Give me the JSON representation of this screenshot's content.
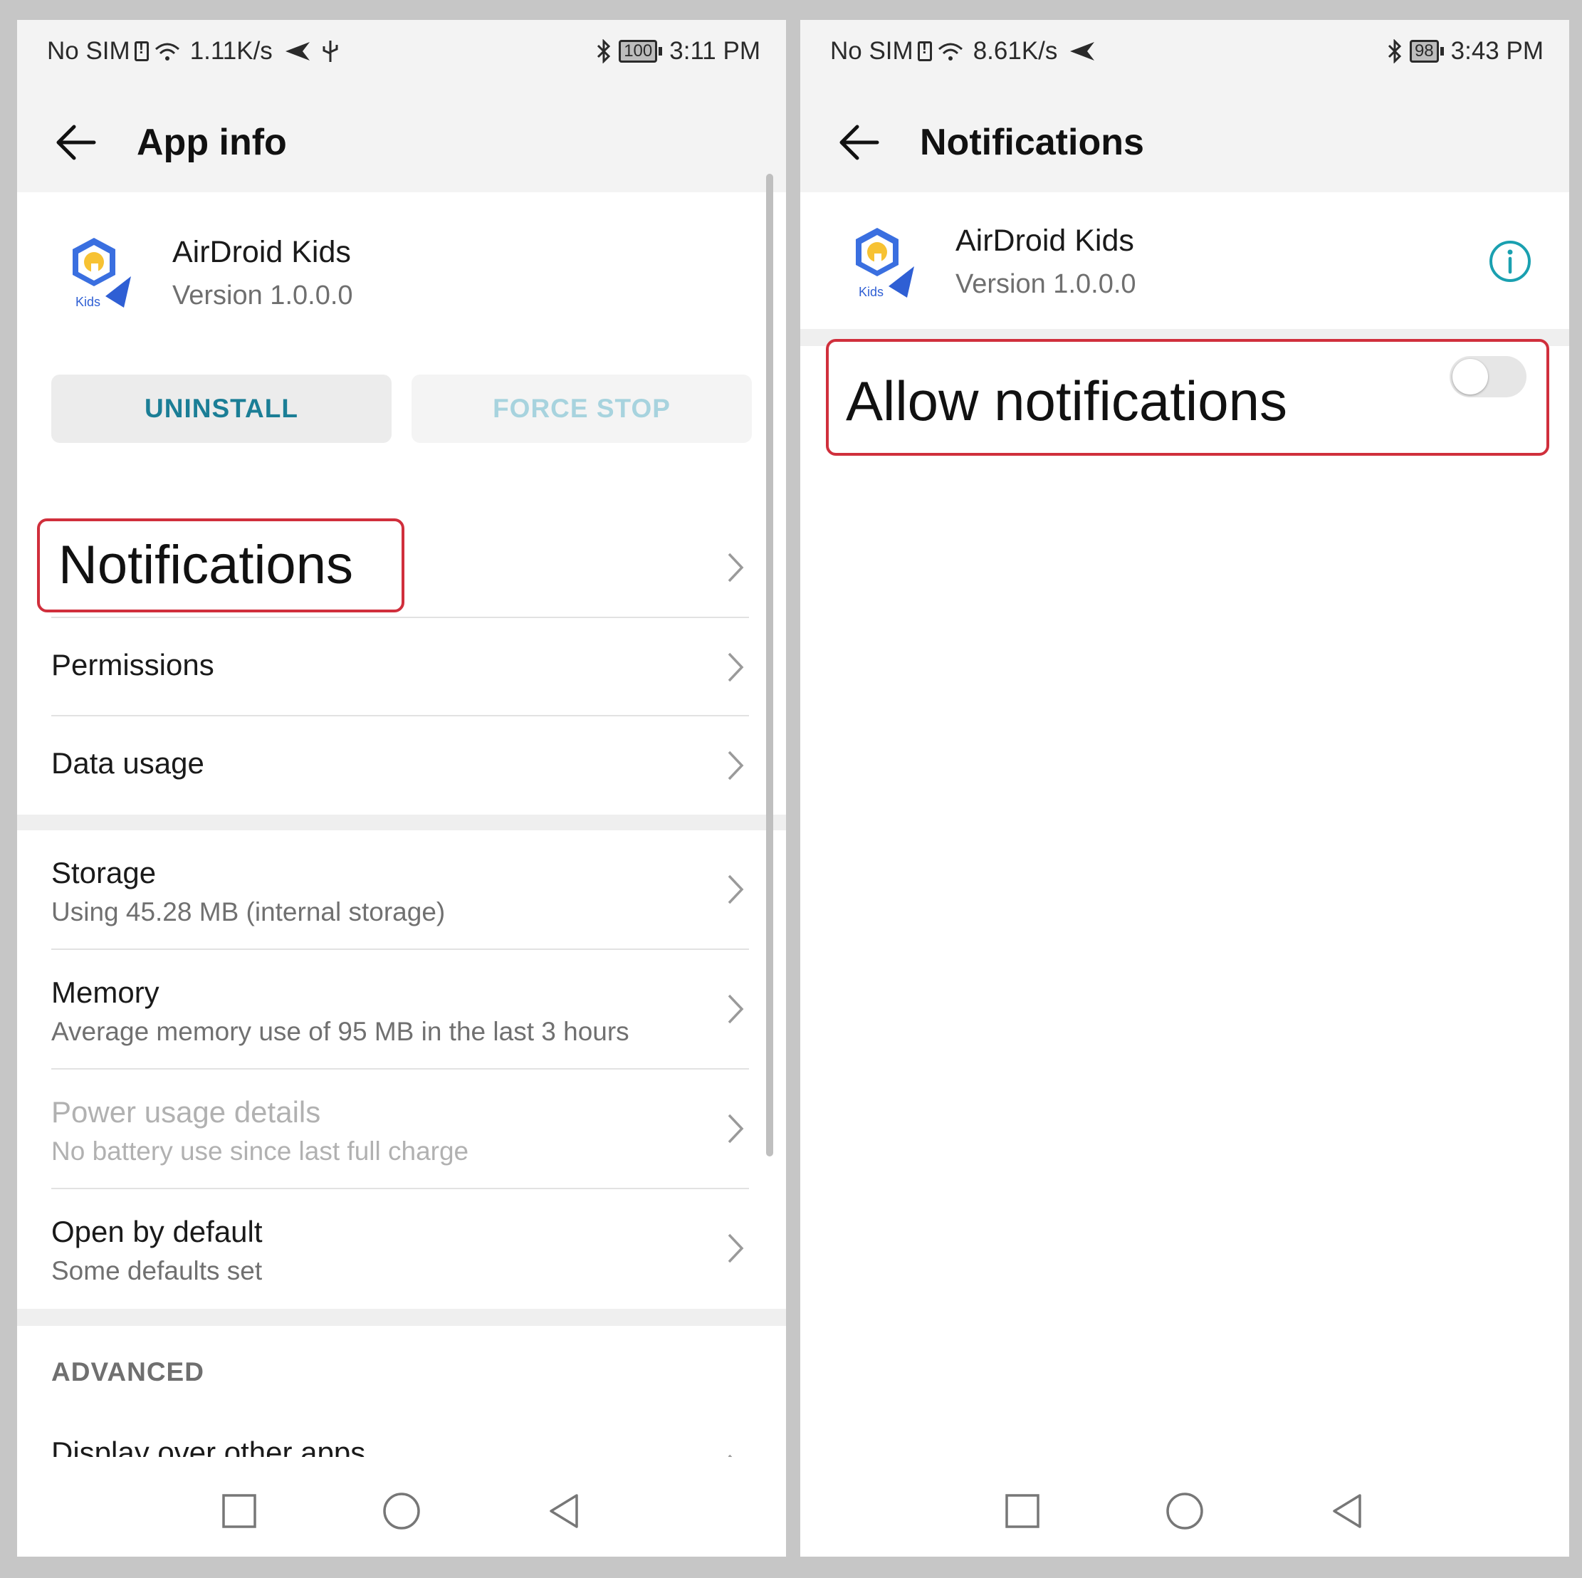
{
  "left": {
    "status": {
      "carrier": "No SIM",
      "speed": "1.11K/s",
      "battery": "100",
      "time": "3:11 PM"
    },
    "title": "App info",
    "app": {
      "name": "AirDroid Kids",
      "version": "Version 1.0.0.0",
      "icon_text": "Kids"
    },
    "buttons": {
      "uninstall": "UNINSTALL",
      "force_stop": "FORCE STOP"
    },
    "items": {
      "notifications": "Notifications",
      "permissions": "Permissions",
      "data_usage": "Data usage",
      "storage": {
        "title": "Storage",
        "subtitle": "Using 45.28 MB (internal storage)"
      },
      "memory": {
        "title": "Memory",
        "subtitle": "Average memory use of 95 MB in the last 3 hours"
      },
      "power": {
        "title": "Power usage details",
        "subtitle": "No battery use since last full charge"
      },
      "open_default": {
        "title": "Open by default",
        "subtitle": "Some defaults set"
      },
      "advanced_header": "ADVANCED",
      "display_over": "Display over other apps"
    }
  },
  "right": {
    "status": {
      "carrier": "No SIM",
      "speed": "8.61K/s",
      "battery": "98",
      "time": "3:43 PM"
    },
    "title": "Notifications",
    "app": {
      "name": "AirDroid Kids",
      "version": "Version 1.0.0.0",
      "icon_text": "Kids"
    },
    "allow_notifications": {
      "label": "Allow notifications",
      "enabled": false
    }
  },
  "icons": [
    "back-arrow-icon",
    "chevron-right-icon",
    "info-icon",
    "wifi-icon",
    "bluetooth-icon",
    "sim-icon",
    "send-icon",
    "usb-icon",
    "recents-icon",
    "home-icon",
    "back-nav-icon"
  ],
  "colors": {
    "accent": "#1b7e96",
    "highlight": "#d02f3c",
    "info": "#1aa0b0"
  }
}
